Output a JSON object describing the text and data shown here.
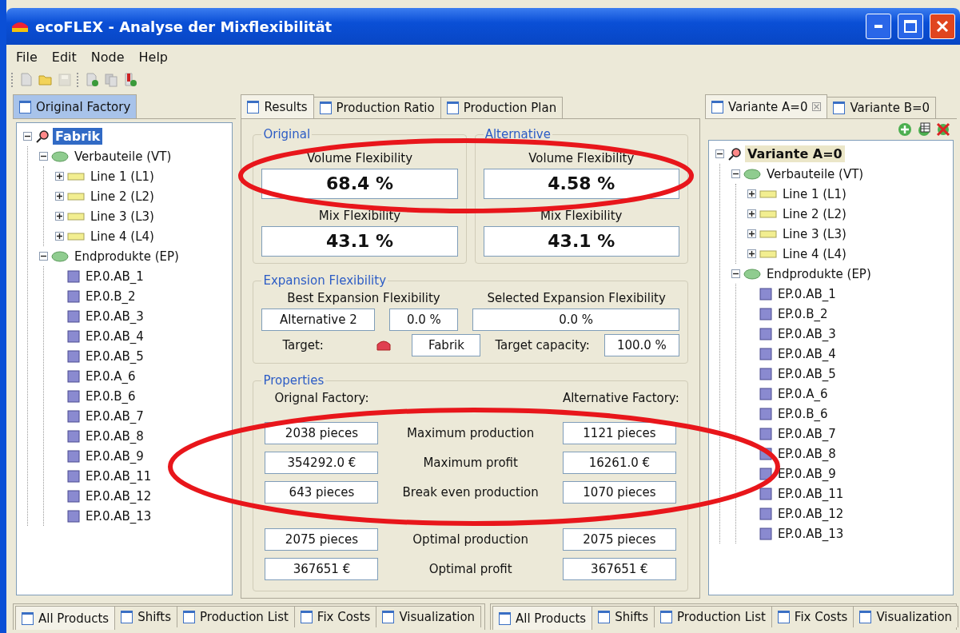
{
  "window": {
    "title": "ecoFLEX - Analyse der Mixflexibilität"
  },
  "menu": [
    "File",
    "Edit",
    "Node",
    "Help"
  ],
  "toolbar": [
    [
      {
        "kind": "new",
        "disabled": false
      },
      {
        "kind": "open",
        "disabled": false
      },
      {
        "kind": "save",
        "disabled": true
      }
    ],
    [
      {
        "kind": "add",
        "disabled": false
      },
      {
        "kind": "copy",
        "disabled": false
      },
      {
        "kind": "mark",
        "disabled": false
      }
    ]
  ],
  "left_panel": {
    "focused": true,
    "tabs": [
      {
        "label": "Original Factory",
        "selected": true,
        "closable": false
      }
    ],
    "tree": {
      "label": "Fabrik",
      "kind": "root",
      "expanded": true,
      "selected": true,
      "children": [
        {
          "label": "Verbauteile (VT)",
          "kind": "group",
          "expanded": true,
          "selected": false,
          "children": [
            {
              "label": "Line 1 (L1)",
              "kind": "line",
              "expanded": false,
              "selected": false
            },
            {
              "label": "Line 2 (L2)",
              "kind": "line",
              "expanded": false,
              "selected": false
            },
            {
              "label": "Line 3 (L3)",
              "kind": "line",
              "expanded": false,
              "selected": false
            },
            {
              "label": "Line 4 (L4)",
              "kind": "line",
              "expanded": false,
              "selected": false
            }
          ]
        },
        {
          "label": "Endprodukte (EP)",
          "kind": "group",
          "expanded": true,
          "selected": false,
          "children": [
            {
              "label": "EP.0.AB_1",
              "kind": "product",
              "selected": false
            },
            {
              "label": "EP.0.B_2",
              "kind": "product",
              "selected": false
            },
            {
              "label": "EP.0.AB_3",
              "kind": "product",
              "selected": false
            },
            {
              "label": "EP.0.AB_4",
              "kind": "product",
              "selected": false
            },
            {
              "label": "EP.0.AB_5",
              "kind": "product",
              "selected": false
            },
            {
              "label": "EP.0.A_6",
              "kind": "product",
              "selected": false
            },
            {
              "label": "EP.0.B_6",
              "kind": "product",
              "selected": false
            },
            {
              "label": "EP.0.AB_7",
              "kind": "product",
              "selected": false
            },
            {
              "label": "EP.0.AB_8",
              "kind": "product",
              "selected": false
            },
            {
              "label": "EP.0.AB_9",
              "kind": "product",
              "selected": false
            },
            {
              "label": "EP.0.AB_11",
              "kind": "product",
              "selected": false
            },
            {
              "label": "EP.0.AB_12",
              "kind": "product",
              "selected": false
            },
            {
              "label": "EP.0.AB_13",
              "kind": "product",
              "selected": false
            }
          ]
        }
      ]
    }
  },
  "center_panel": {
    "tabs": [
      {
        "label": "Results",
        "selected": true
      },
      {
        "label": "Production Ratio",
        "selected": false
      },
      {
        "label": "Production Plan",
        "selected": false
      }
    ],
    "original": {
      "title": "Original",
      "volume_label": "Volume Flexibility",
      "volume_value": "68.4 %",
      "mix_label": "Mix Flexibility",
      "mix_value": "43.1 %"
    },
    "alternative": {
      "title": "Alternative",
      "volume_label": "Volume Flexibility",
      "volume_value": "4.58 %",
      "mix_label": "Mix Flexibility",
      "mix_value": "43.1 %"
    },
    "expansion": {
      "title": "Expansion Flexibility",
      "best_label": "Best Expansion Flexibility",
      "selected_label": "Selected Expansion Flexibility",
      "best_value": "Alternative 2",
      "best_percent": "0.0 %",
      "selected_percent": "0.0 %",
      "target_label": "Target:",
      "target_value": "Fabrik",
      "capacity_label": "Target capacity:",
      "capacity_value": "100.0 %"
    },
    "properties": {
      "title": "Properties",
      "left_heading": "Orignal Factory:",
      "right_heading": "Alternative Factory:",
      "rows": [
        {
          "label": "Maximum production",
          "original": "2038 pieces",
          "alternative": "1121 pieces"
        },
        {
          "label": "Maximum profit",
          "original": "354292.0 €",
          "alternative": "16261.0 €"
        },
        {
          "label": "Break even production",
          "original": "643 pieces",
          "alternative": "1070 pieces"
        },
        {
          "label": "Optimal production",
          "original": "2075 pieces",
          "alternative": "2075 pieces"
        },
        {
          "label": "Optimal profit",
          "original": "367651 €",
          "alternative": "367651 €"
        }
      ]
    }
  },
  "right_panel": {
    "focused": false,
    "tabs": [
      {
        "label": "Variante A=0",
        "selected": true,
        "closable": true
      },
      {
        "label": "Variante B=0",
        "selected": false,
        "closable": false
      }
    ],
    "tools": [
      {
        "kind": "add"
      },
      {
        "kind": "table"
      },
      {
        "kind": "delete"
      }
    ],
    "tree": {
      "label": "Variante A=0",
      "kind": "root",
      "expanded": true,
      "selected": true,
      "children": [
        {
          "label": "Verbauteile (VT)",
          "kind": "group",
          "expanded": true,
          "selected": false,
          "children": [
            {
              "label": "Line 1 (L1)",
              "kind": "line",
              "expanded": false,
              "selected": false
            },
            {
              "label": "Line 2 (L2)",
              "kind": "line",
              "expanded": false,
              "selected": false
            },
            {
              "label": "Line 3 (L3)",
              "kind": "line",
              "expanded": false,
              "selected": false
            },
            {
              "label": "Line 4 (L4)",
              "kind": "line",
              "expanded": false,
              "selected": false
            }
          ]
        },
        {
          "label": "Endprodukte (EP)",
          "kind": "group",
          "expanded": true,
          "selected": false,
          "children": [
            {
              "label": "EP.0.AB_1",
              "kind": "product",
              "selected": false
            },
            {
              "label": "EP.0.B_2",
              "kind": "product",
              "selected": false
            },
            {
              "label": "EP.0.AB_3",
              "kind": "product",
              "selected": false
            },
            {
              "label": "EP.0.AB_4",
              "kind": "product",
              "selected": false
            },
            {
              "label": "EP.0.AB_5",
              "kind": "product",
              "selected": false
            },
            {
              "label": "EP.0.A_6",
              "kind": "product",
              "selected": false
            },
            {
              "label": "EP.0.B_6",
              "kind": "product",
              "selected": false
            },
            {
              "label": "EP.0.AB_7",
              "kind": "product",
              "selected": false
            },
            {
              "label": "EP.0.AB_8",
              "kind": "product",
              "selected": false
            },
            {
              "label": "EP.0.AB_9",
              "kind": "product",
              "selected": false
            },
            {
              "label": "EP.0.AB_11",
              "kind": "product",
              "selected": false
            },
            {
              "label": "EP.0.AB_12",
              "kind": "product",
              "selected": false
            },
            {
              "label": "EP.0.AB_13",
              "kind": "product",
              "selected": false
            }
          ]
        }
      ]
    }
  },
  "bottom_left_tabs": [
    {
      "label": "All Products",
      "selected": true
    },
    {
      "label": "Shifts",
      "selected": false
    },
    {
      "label": "Production List",
      "selected": false
    },
    {
      "label": "Fix Costs",
      "selected": false
    },
    {
      "label": "Visualization",
      "selected": false
    }
  ],
  "bottom_right_tabs": [
    {
      "label": "All Products",
      "selected": true
    },
    {
      "label": "Shifts",
      "selected": false
    },
    {
      "label": "Production List",
      "selected": false
    },
    {
      "label": "Fix Costs",
      "selected": false
    },
    {
      "label": "Visualization",
      "selected": false
    }
  ]
}
